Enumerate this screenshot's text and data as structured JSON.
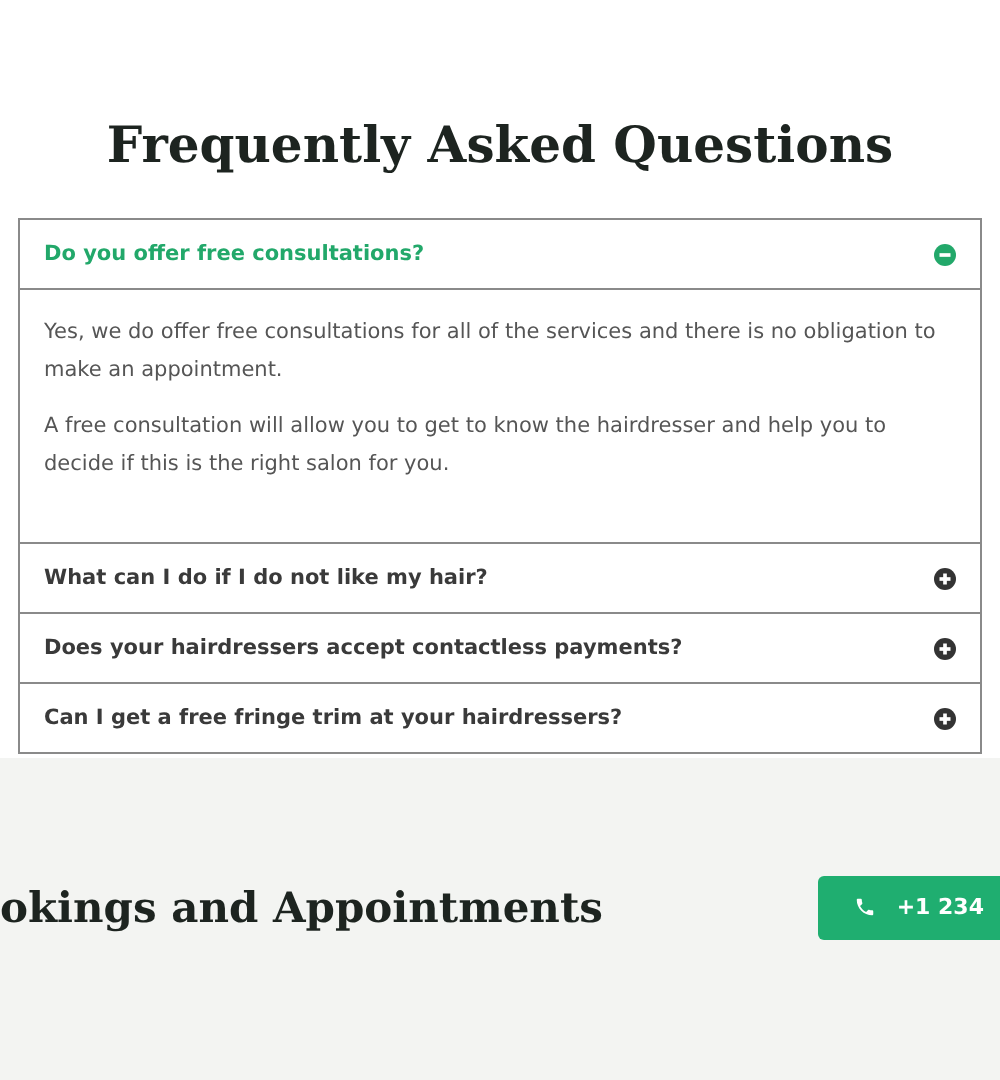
{
  "faq": {
    "title": "Frequently Asked Questions",
    "items": [
      {
        "question": "Do you offer free consultations?",
        "expanded": true,
        "answer": [
          "Yes, we do offer free consultations for all of the services and there is no obligation to make an appointment.",
          "A free consultation will allow you to get to know the hairdresser and help you to decide if this is the right salon for you."
        ]
      },
      {
        "question": "What can I do if I do not like my hair?",
        "expanded": false
      },
      {
        "question": "Does your hairdressers accept contactless payments?",
        "expanded": false
      },
      {
        "question": "Can I get a free fringe trim at your hairdressers?",
        "expanded": false
      }
    ]
  },
  "bookings": {
    "title": "okings and Appointments",
    "phone": "+1 234"
  }
}
